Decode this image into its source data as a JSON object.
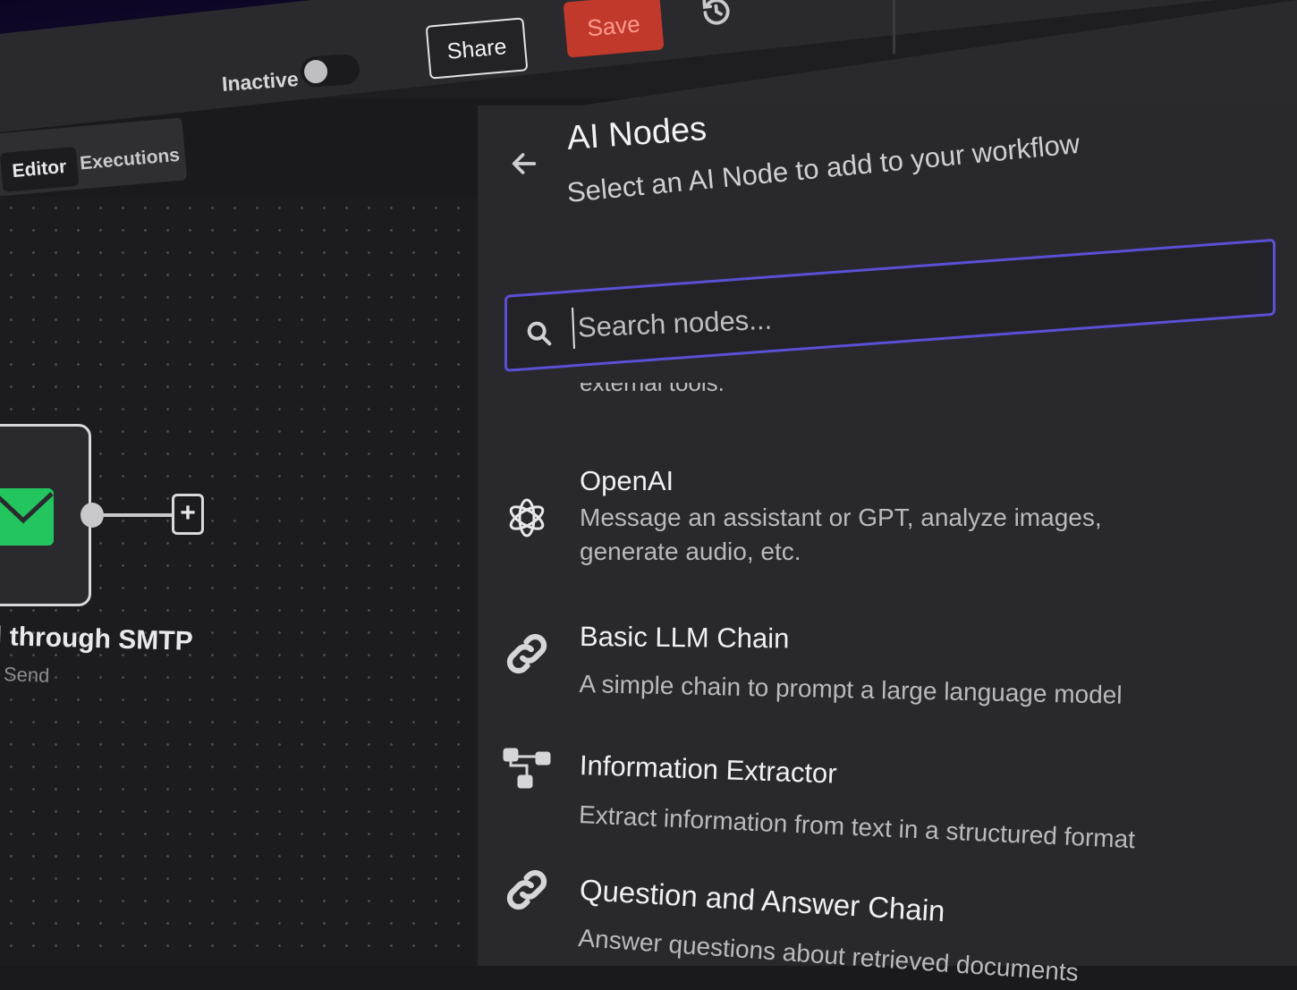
{
  "header": {
    "status_label": "Inactive",
    "share_label": "Share",
    "save_label": "Save",
    "active": false
  },
  "tabs": [
    {
      "label": "Editor",
      "selected": true
    },
    {
      "label": "Executions",
      "selected": false
    }
  ],
  "canvas": {
    "node": {
      "title": "l through SMTP",
      "subtitle": "Send",
      "icon": "envelope-icon",
      "icon_color": "#22c55e"
    }
  },
  "panel": {
    "title": "AI Nodes",
    "subtitle": "Select an AI Node to add to your workflow",
    "search": {
      "placeholder": "Search nodes...",
      "value": ""
    },
    "cut_off_text": "external tools.",
    "items": [
      {
        "title": "OpenAI",
        "description": "Message an assistant or GPT, analyze images, generate audio, etc.",
        "icon": "openai-icon"
      },
      {
        "title": "Basic LLM Chain",
        "description": "A simple chain to prompt a large language model",
        "icon": "link-icon"
      },
      {
        "title": "Information Extractor",
        "description": "Extract information from text in a structured format",
        "icon": "tree-structure-icon"
      },
      {
        "title": "Question and Answer Chain",
        "description": "Answer questions about retrieved documents",
        "icon": "link-icon"
      }
    ]
  },
  "colors": {
    "accent_focus": "#5b4fd6",
    "save_button": "#c0392b",
    "panel_background": "#29292d",
    "canvas_background": "#1c1c1f"
  }
}
